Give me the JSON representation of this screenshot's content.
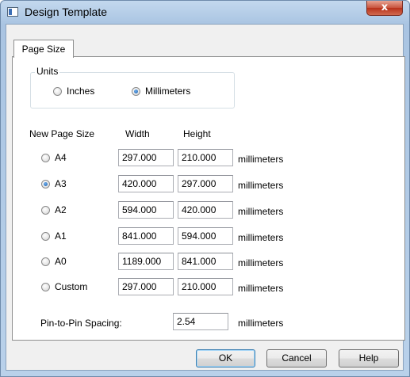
{
  "window": {
    "title": "Design Template",
    "close_glyph": "x"
  },
  "tabs": [
    {
      "label": "Page Size"
    }
  ],
  "units": {
    "group_label": "Units",
    "options": [
      {
        "label": "Inches",
        "checked": false
      },
      {
        "label": "Millimeters",
        "checked": true
      }
    ]
  },
  "sizes": {
    "headers": {
      "size": "New Page Size",
      "width": "Width",
      "height": "Height"
    },
    "rows": [
      {
        "label": "A4",
        "width": "297.000",
        "height": "210.000",
        "unit": "millimeters",
        "checked": false
      },
      {
        "label": "A3",
        "width": "420.000",
        "height": "297.000",
        "unit": "millimeters",
        "checked": true
      },
      {
        "label": "A2",
        "width": "594.000",
        "height": "420.000",
        "unit": "millimeters",
        "checked": false
      },
      {
        "label": "A1",
        "width": "841.000",
        "height": "594.000",
        "unit": "millimeters",
        "checked": false
      },
      {
        "label": "A0",
        "width": "1189.000",
        "height": "841.000",
        "unit": "millimeters",
        "checked": false
      },
      {
        "label": "Custom",
        "width": "297.000",
        "height": "210.000",
        "unit": "millimeters",
        "checked": false
      }
    ]
  },
  "pin_spacing": {
    "label": "Pin-to-Pin Spacing:",
    "value": "2.54",
    "unit": "millimeters"
  },
  "buttons": {
    "ok": "OK",
    "cancel": "Cancel",
    "help": "Help"
  }
}
